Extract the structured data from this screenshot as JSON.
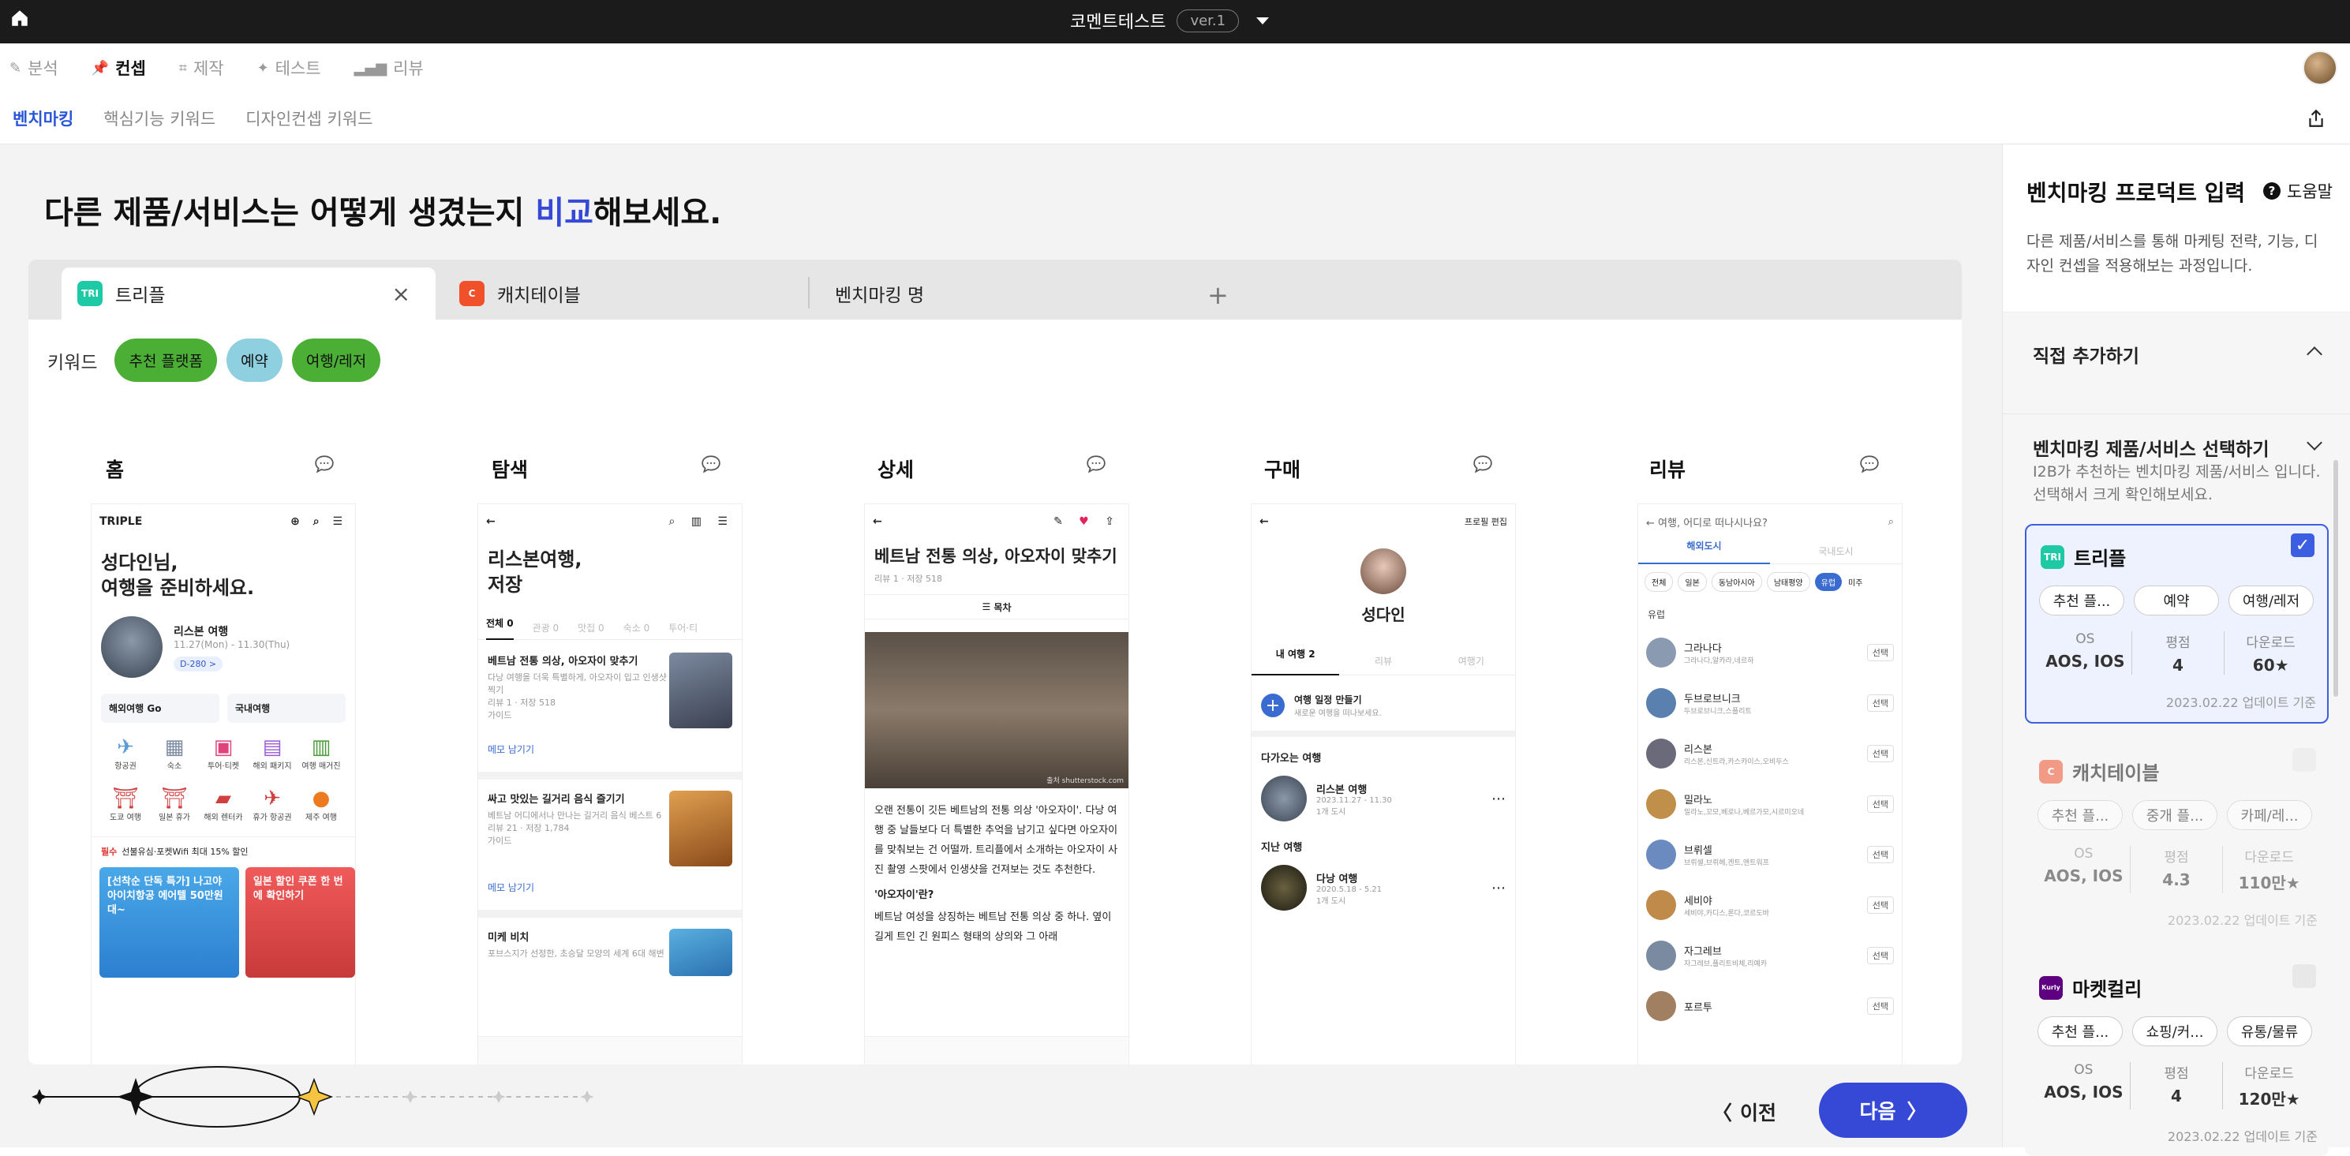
{
  "topbar": {
    "title": "코멘트테스트",
    "version": "ver.1"
  },
  "nav1": [
    {
      "label": "분석",
      "icon": "edit-icon",
      "active": false
    },
    {
      "label": "컨셉",
      "icon": "pin-icon",
      "active": true
    },
    {
      "label": "제작",
      "icon": "crop-icon",
      "active": false
    },
    {
      "label": "테스트",
      "icon": "sparkle-icon",
      "active": false
    },
    {
      "label": "리뷰",
      "icon": "bar-chart-icon",
      "active": false
    }
  ],
  "nav2": [
    "벤치마킹",
    "핵심기능 키워드",
    "디자인컨셉 키워드"
  ],
  "headline": {
    "pre": "다른 제품/서비스는 어떻게 생겼는지 ",
    "hl": "비교",
    "post": "해보세요."
  },
  "tabs": [
    {
      "label": "트리플",
      "logo": "TRI"
    },
    {
      "label": "캐치테이블",
      "logo": "C"
    },
    {
      "label": "벤치마킹 명"
    }
  ],
  "keywords": {
    "label": "키워드",
    "chips": [
      "추천 플랫폼",
      "예약",
      "여행/레저"
    ]
  },
  "columns": [
    "홈",
    "탐색",
    "상세",
    "구매",
    "리뷰"
  ],
  "screens": {
    "home": {
      "brand": "TRIPLE",
      "greeting1": "성다인님,",
      "greeting2": "여행을 준비하세요.",
      "trip": "리스본 여행",
      "trip_date": "11.27(Mon) - 11.30(Thu)",
      "dday": "D-280 >",
      "btn1": "해외여행 Go",
      "btn2": "국내여행",
      "icons": [
        "항공권",
        "숙소",
        "투어·티켓",
        "해외 패키지",
        "여행 매거진",
        "도쿄 여행",
        "일본 휴가",
        "해외 렌터카",
        "휴가 항공권",
        "제주 여행"
      ],
      "promo": "선불유심·포켓Wifi 최대 15% 할인",
      "promo_tag": "필수",
      "banner1": "[선착순 단독 특가] 나고야 아이치항공 에어텔 50만원대~",
      "banner2": "일본 할인 쿠폰 한 번에 확인하기"
    },
    "explore": {
      "title1": "리스본여행,",
      "title2": "저장",
      "tabs": [
        "전체 0",
        "관광 0",
        "맛집 0",
        "숙소 0",
        "투어·티"
      ],
      "item1": "베트남 전통 의상, 아오자이 맞추기",
      "item1_desc": "다낭 여행을 더욱 특별하게, 아오자이 입고 인생샷 찍기",
      "item1_meta": "리뷰 1 · 저장 518",
      "item1_type": "가이드",
      "memo": "메모 남기기",
      "item2": "싸고 맛있는 길거리 음식 즐기기",
      "item2_desc": "베트남 어디에서나 만나는 길거리 음식 베스트 6",
      "item2_meta": "리뷰 21 · 저장 1,784",
      "item2_type": "가이드",
      "item3": "미케 비치",
      "item3_desc": "포브스지가 선정한, 초승달 모양의 세계 6대 해변"
    },
    "detail": {
      "title": "베트남 전통 의상, 아오자이 맞추기",
      "meta": "리뷰 1 · 저장 518",
      "toc": "목차",
      "photo_credit": "출처 shutterstock.com",
      "p1": "오랜 전통이 깃든 베트남의 전통 의상 '아오자이'. 다낭 여행 중 날들보다 더 특별한 추억을 남기고 싶다면 아오자이를 맞춰보는 건 어떨까. 트리플에서 소개하는 아오자이 사진 촬영 스팟에서 인생샷을 건져보는 것도 추천한다.",
      "h2": "'아오자이'란?",
      "p2": "베트남 여성을 상징하는 베트남 전통 의상 중 하나. 옆이 길게 트인 긴 원피스 형태의 상의와 그 아래"
    },
    "purchase": {
      "edit": "프로필 편집",
      "name": "성다인",
      "tabs": [
        "내 여행 2",
        "리뷰",
        "여행기"
      ],
      "make": "여행 일정 만들기",
      "make_sub": "새로운 여행을 떠나보세요.",
      "upcoming": "다가오는 여행",
      "trip1": "리스본 여행",
      "trip1_date": "2023.11.27 - 11.30",
      "trip1_sub": "1개 도시",
      "past": "지난 여행",
      "trip2": "다낭 여행",
      "trip2_date": "2020.5.18 - 5.21",
      "trip2_sub": "1개 도시"
    },
    "review": {
      "search": "여행, 어디로 떠나시나요?",
      "tabs": [
        "해외도시",
        "국내도시"
      ],
      "filters": [
        "전체",
        "일본",
        "동남아시아",
        "남태평양",
        "유럽",
        "미주"
      ],
      "region": "유럽",
      "select": "선택",
      "cities": [
        {
          "name": "그라나다",
          "sub": "그라나다,알카라,네르하"
        },
        {
          "name": "두브로브니크",
          "sub": "두브로브니크,스플리트"
        },
        {
          "name": "리스본",
          "sub": "리스본,신트라,카스카이스,오비두스"
        },
        {
          "name": "밀라노",
          "sub": "밀라노,꼬모,베로나,베르가모,시르미오네"
        },
        {
          "name": "브뤼셀",
          "sub": "브뤼셀,브뤼헤,겐트,앤트워프"
        },
        {
          "name": "세비야",
          "sub": "세비야,카디스,론다,코르도바"
        },
        {
          "name": "자그레브",
          "sub": "자그레브,플리트비체,리예카"
        },
        {
          "name": "포르투",
          "sub": ""
        }
      ]
    }
  },
  "nav_buttons": {
    "prev": "이전",
    "next": "다음"
  },
  "sidebar": {
    "title": "벤치마킹 프로덕트 입력",
    "help": "도움말",
    "desc": "다른 제품/서비스를 통해 마케팅 전략, 기능, 디자인 컨셉을 적용해보는 과정입니다.",
    "direct": "직접 추가하기",
    "select_title": "벤치마킹 제품/서비스 선택하기",
    "select_desc": "I2B가 추천하는 벤치마킹 제품/서비스 입니다. 선택해서 크게 확인해보세요.",
    "stat_labels": [
      "OS",
      "평점",
      "다운로드"
    ],
    "cards": [
      {
        "name": "트리플",
        "logo": "TRI",
        "chips": [
          "추천 플...",
          "예약",
          "여행/레저"
        ],
        "os": "AOS, IOS",
        "rating": "4",
        "downloads": "60★",
        "updated": "2023.02.22 업데이트 기준",
        "checked": true
      },
      {
        "name": "캐치테이블",
        "logo": "C",
        "chips": [
          "추천 플...",
          "중개 플...",
          "카페/레..."
        ],
        "os": "AOS, IOS",
        "rating": "4.3",
        "downloads": "110만★",
        "updated": "2023.02.22 업데이트 기준",
        "checked": false
      },
      {
        "name": "마켓컬리",
        "logo": "Kurly",
        "chips": [
          "추천 플...",
          "쇼핑/커...",
          "유통/물류"
        ],
        "os": "AOS, IOS",
        "rating": "4",
        "downloads": "120만★",
        "updated": "2023.02.22 업데이트 기준",
        "checked": false
      }
    ]
  },
  "colors": {
    "accent": "#3549d6",
    "keyword_green": "#4caf35",
    "keyword_blue": "#8ecfe0",
    "triple": "#1ecaa5",
    "catch": "#f0502a",
    "kurly": "#5f0080"
  }
}
